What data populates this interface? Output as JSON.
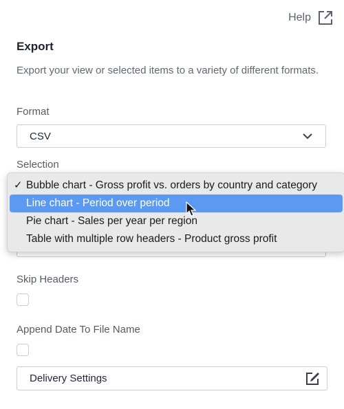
{
  "help": {
    "label": "Help",
    "icon": "external-link-icon"
  },
  "title": "Export",
  "description": "Export your view or selected items to a variety of different formats.",
  "format": {
    "label": "Format",
    "value": "CSV",
    "icon": "chevron-down-icon"
  },
  "selection": {
    "label": "Selection",
    "options": [
      {
        "label": "Bubble chart - Gross profit vs. orders by country and category",
        "checked": true
      },
      {
        "label": "Line chart - Period over period",
        "highlighted": true
      },
      {
        "label": "Pie chart - Sales per year per region"
      },
      {
        "label": "Table with multiple row headers - Product gross profit"
      }
    ]
  },
  "skip_headers": {
    "label": "Skip Headers",
    "checked": false
  },
  "append_date": {
    "label": "Append Date To File Name",
    "checked": false
  },
  "delivery": {
    "label": "Delivery Settings",
    "icon": "edit-icon"
  },
  "colors": {
    "highlight": "#5b9af0",
    "border": "#c9ccd3",
    "text": "#23273a"
  }
}
